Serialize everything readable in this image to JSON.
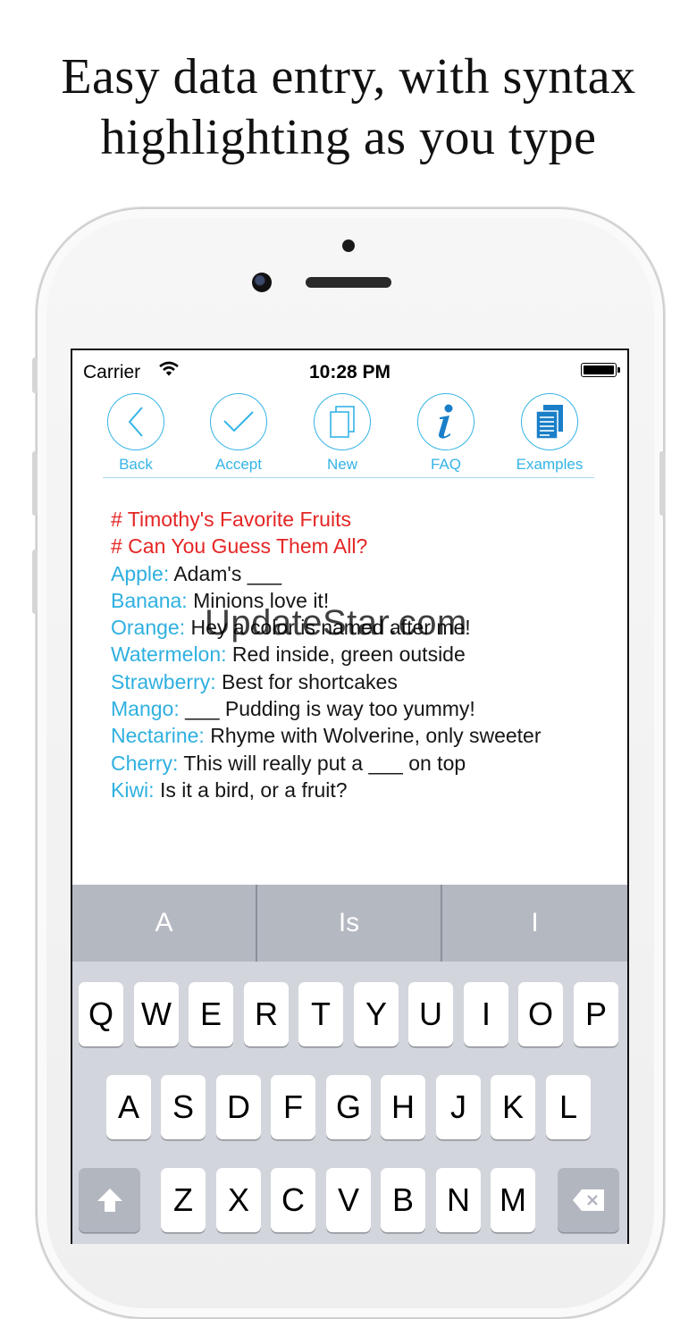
{
  "headline": {
    "line1": "Easy data entry, with syntax",
    "line2": "highlighting as you type"
  },
  "status_bar": {
    "carrier": "Carrier",
    "time": "10:28 PM"
  },
  "toolbar": {
    "buttons": [
      {
        "label": "Back",
        "icon": "chevron-left-icon"
      },
      {
        "label": "Accept",
        "icon": "checkmark-icon"
      },
      {
        "label": "New",
        "icon": "documents-icon"
      },
      {
        "label": "FAQ",
        "icon": "info-icon"
      },
      {
        "label": "Examples",
        "icon": "document-list-icon"
      }
    ]
  },
  "editor": {
    "comments": [
      "# Timothy's Favorite Fruits",
      "# Can You Guess Them All?"
    ],
    "entries": [
      {
        "key": "Apple:",
        "value": " Adam's ___"
      },
      {
        "key": "Banana:",
        "value": " Minions love it!"
      },
      {
        "key": "Orange:",
        "value": " Hey a color is named after me!"
      },
      {
        "key": "Watermelon:",
        "value": " Red inside, green outside"
      },
      {
        "key": "Strawberry:",
        "value": " Best for shortcakes"
      },
      {
        "key": "Mango:",
        "value": " ___ Pudding is way too yummy!"
      },
      {
        "key": "Nectarine:",
        "value": " Rhyme with Wolverine, only sweeter"
      },
      {
        "key": "Cherry:",
        "value": " This will really put a ___ on top"
      },
      {
        "key": "Kiwi:",
        "value": " Is it a bird, or a fruit?"
      }
    ]
  },
  "watermark": "UpdateStar.com",
  "keyboard": {
    "suggestions": [
      "A",
      "Is",
      "I"
    ],
    "row1": [
      "Q",
      "W",
      "E",
      "R",
      "T",
      "Y",
      "U",
      "I",
      "O",
      "P"
    ],
    "row2": [
      "A",
      "S",
      "D",
      "F",
      "G",
      "H",
      "J",
      "K",
      "L"
    ],
    "row3": [
      "Z",
      "X",
      "C",
      "V",
      "B",
      "N",
      "M"
    ],
    "shift_icon": "shift-arrow-icon",
    "delete_icon": "backspace-icon"
  },
  "colors": {
    "accent": "#35b4e6",
    "comment": "#e52525",
    "key_text": "#2fb0e0",
    "value_text": "#161616"
  }
}
